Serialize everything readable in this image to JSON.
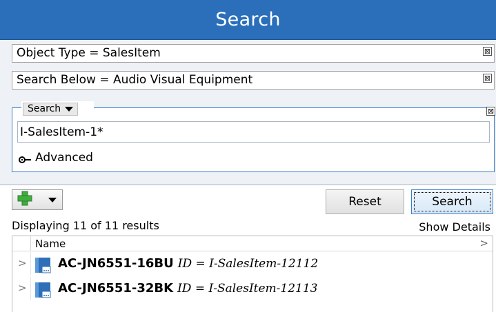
{
  "header": {
    "title": "Search"
  },
  "criteria": [
    {
      "text": "Object Type = SalesItem",
      "close": "⊠"
    },
    {
      "text": "Search Below = Audio Visual Equipment",
      "close": "⊠"
    }
  ],
  "search_group": {
    "mode_label": "Search",
    "close": "⊠",
    "query_value": "I-SalesItem-1*",
    "advanced_label": "Advanced"
  },
  "toolbar": {
    "reset_label": "Reset",
    "search_label": "Search",
    "add_icon": "plus-icon",
    "colors": {
      "add_green": "#3fae3f",
      "accent": "#2b6fba"
    }
  },
  "results": {
    "count_text": "Displaying 11 of 11 results",
    "show_details_label": "Show Details",
    "columns": [
      "Name"
    ],
    "rows": [
      {
        "name": "AC-JN6551-16BU",
        "id_text": "ID = I-SalesItem-12112"
      },
      {
        "name": "AC-JN6551-32BK",
        "id_text": "ID = I-SalesItem-12113"
      }
    ]
  }
}
